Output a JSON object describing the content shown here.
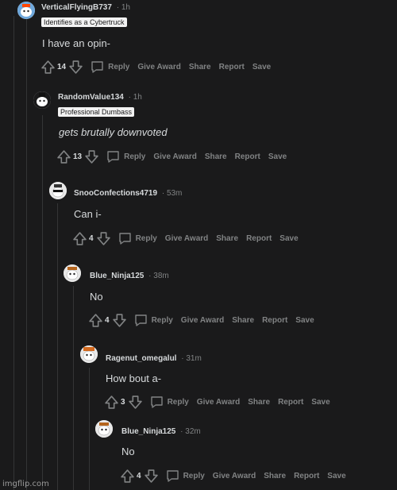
{
  "comments": [
    {
      "username": "VerticalFlyingB737",
      "time": "1h",
      "flair": "Identifies as a Cybertruck",
      "text": "I have an opin-",
      "score": "14",
      "italic": false
    },
    {
      "username": "RandomValue134",
      "time": "1h",
      "flair": "Professional Dumbass",
      "text": "gets brutally downvoted",
      "score": "13",
      "italic": true
    },
    {
      "username": "SnooConfections4719",
      "time": "53m",
      "flair": "",
      "text": "Can i-",
      "score": "4",
      "italic": false
    },
    {
      "username": "Blue_Ninja125",
      "time": "38m",
      "flair": "",
      "text": "No",
      "score": "4",
      "italic": false
    },
    {
      "username": "Ragenut_omegalul",
      "time": "31m",
      "flair": "",
      "text": "How bout a-",
      "score": "3",
      "italic": false
    },
    {
      "username": "Blue_Ninja125",
      "time": "32m",
      "flair": "",
      "text": "No",
      "score": "4",
      "italic": false
    }
  ],
  "actions": {
    "reply": "Reply",
    "give_award": "Give Award",
    "share": "Share",
    "report": "Report",
    "save": "Save"
  },
  "time_separator": "·",
  "watermark": "imgflip.com",
  "colors": {
    "background": "#1a1a1b",
    "text": "#d7dadc",
    "muted": "#818384",
    "rail": "#343536"
  }
}
